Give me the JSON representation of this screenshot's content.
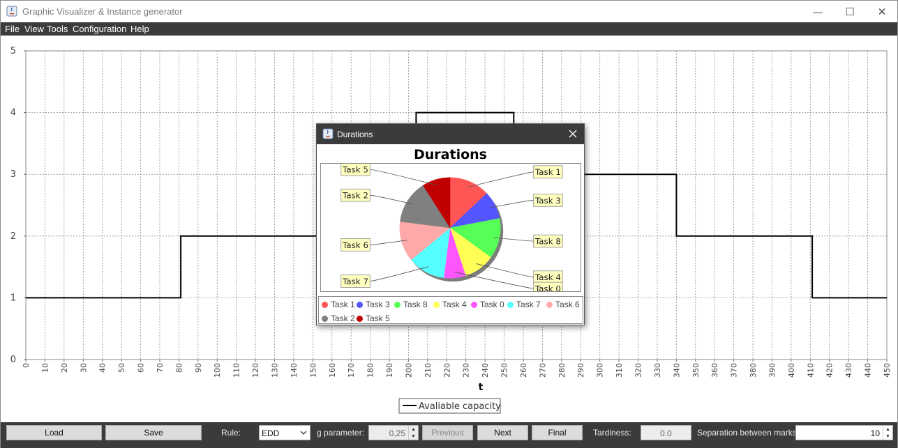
{
  "window": {
    "title": "Graphic Visualizer & Instance generator",
    "controls": [
      "—",
      "☐",
      "✕"
    ]
  },
  "menu": [
    "File",
    "View",
    "Tools",
    "Configuration",
    "Help"
  ],
  "chart_data": {
    "type": "line",
    "step": true,
    "xlabel": "t",
    "ylabel": "",
    "ylim": [
      0,
      5
    ],
    "xlim": [
      0,
      450
    ],
    "x_ticks": [
      0,
      10,
      20,
      30,
      40,
      50,
      60,
      70,
      80,
      90,
      100,
      110,
      120,
      130,
      140,
      150,
      160,
      170,
      180,
      190,
      200,
      210,
      220,
      230,
      240,
      250,
      260,
      270,
      280,
      290,
      300,
      310,
      320,
      330,
      340,
      350,
      360,
      370,
      380,
      390,
      400,
      410,
      420,
      430,
      440,
      450
    ],
    "y_ticks": [
      0,
      1,
      2,
      3,
      4,
      5
    ],
    "grid": true,
    "legend_position": "bottom-center",
    "series": [
      {
        "name": "Avaliable capacity",
        "color": "#000000",
        "points": [
          [
            0,
            1
          ],
          [
            81,
            1
          ],
          [
            81,
            2
          ],
          [
            204,
            2
          ],
          [
            204,
            4
          ],
          [
            255,
            4
          ],
          [
            255,
            3
          ],
          [
            340,
            3
          ],
          [
            340,
            2
          ],
          [
            411,
            2
          ],
          [
            411,
            1
          ],
          [
            450,
            1
          ]
        ]
      }
    ]
  },
  "dialog": {
    "title": "Durations",
    "chart_title": "Durations",
    "pie": {
      "type": "pie",
      "slices": [
        {
          "label": "Task 1",
          "value": 13,
          "color": "#ff5555"
        },
        {
          "label": "Task 3",
          "value": 9,
          "color": "#5555ff"
        },
        {
          "label": "Task 8",
          "value": 13,
          "color": "#55ff55"
        },
        {
          "label": "Task 4",
          "value": 10,
          "color": "#ffff55"
        },
        {
          "label": "Task 0",
          "value": 7,
          "color": "#ff55ff"
        },
        {
          "label": "Task 7",
          "value": 12,
          "color": "#55ffff"
        },
        {
          "label": "Task 6",
          "value": 13,
          "color": "#ffaaaa"
        },
        {
          "label": "Task 2",
          "value": 14,
          "color": "#808080"
        },
        {
          "label": "Task 5",
          "value": 9,
          "color": "#c00000"
        }
      ]
    },
    "legend": [
      "Task 1",
      "Task 3",
      "Task 8",
      "Task 4",
      "Task 0",
      "Task 7",
      "Task 6",
      "Task 2",
      "Task 5"
    ]
  },
  "bottom": {
    "load": "Load",
    "save": "Save",
    "rule_label": "Rule:",
    "rule_value": "EDD",
    "g_label": "g parameter:",
    "g_value": "0,25",
    "previous": "Previous",
    "next": "Next",
    "final": "Final",
    "tardiness_label": "Tardiness:",
    "tardiness_value": "0.0",
    "separation_label": "Separation between marks:",
    "separation_value": "10"
  }
}
